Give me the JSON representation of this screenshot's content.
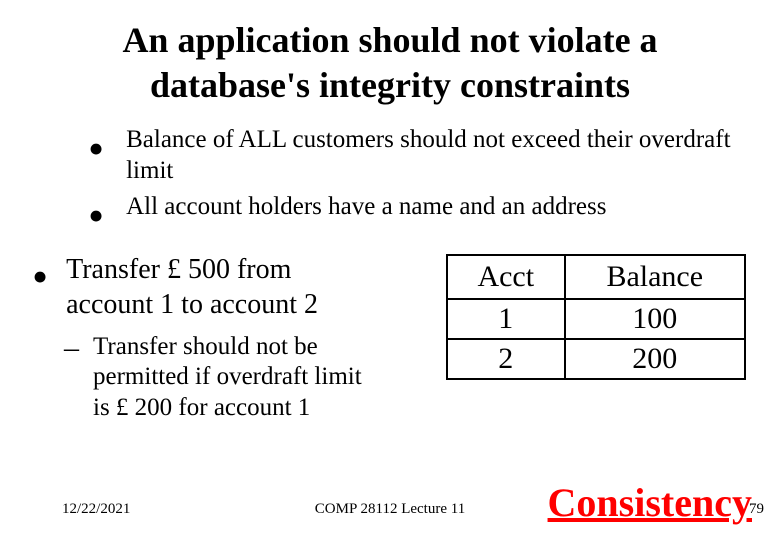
{
  "title_line1": "An application should not violate a",
  "title_line2": "database's integrity constraints",
  "bullets": [
    "Balance of ALL customers should not exceed their overdraft limit",
    "All account holders have a name and an address"
  ],
  "transfer_line1": "Transfer £ 500 from",
  "transfer_line2": "account 1 to account 2",
  "note_line1": "Transfer should not be",
  "note_line2": "permitted if overdraft limit",
  "note_line3": "is £ 200 for account 1",
  "table": {
    "headers": {
      "acct": "Acct",
      "balance": "Balance"
    },
    "rows": [
      {
        "acct": "1",
        "balance": "100"
      },
      {
        "acct": "2",
        "balance": "200"
      }
    ]
  },
  "callout": "Consistency",
  "footer": {
    "date": "12/22/2021",
    "center": "COMP 28112 Lecture 11",
    "page": "79"
  },
  "chart_data": {
    "type": "table",
    "title": "Account balances",
    "headers": [
      "Acct",
      "Balance"
    ],
    "rows": [
      [
        "1",
        100
      ],
      [
        "2",
        200
      ]
    ]
  }
}
